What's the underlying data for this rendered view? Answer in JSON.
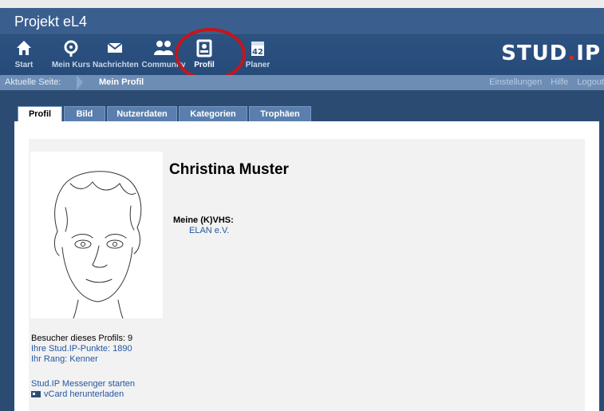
{
  "app": {
    "title": "Projekt eL4",
    "logo_main": "STUD",
    "logo_dot": ".",
    "logo_end": "IP"
  },
  "nav": {
    "items": [
      {
        "label": "Start",
        "icon": "home-icon"
      },
      {
        "label": "Mein Kurs",
        "icon": "course-icon"
      },
      {
        "label": "Nachrichten",
        "icon": "mail-icon"
      },
      {
        "label": "Community",
        "icon": "community-icon"
      },
      {
        "label": "Profil",
        "icon": "profile-icon"
      },
      {
        "label": "Planer",
        "icon": "calendar-icon"
      }
    ],
    "calendar_day": "42"
  },
  "breadcrumb": {
    "label": "Aktuelle Seite:",
    "current": "Mein Profil",
    "links": [
      "Einstellungen",
      "Hilfe",
      "Logout"
    ]
  },
  "tabs": [
    "Profil",
    "Bild",
    "Nutzerdaten",
    "Kategorien",
    "Trophäen"
  ],
  "profile": {
    "name": "Christina Muster",
    "vhs_label": "Meine (K)VHS:",
    "vhs_value": "ELAN e.V.",
    "visitors": "Besucher dieses Profils: 9",
    "points": "Ihre Stud.IP-Punkte: 1890",
    "rank": "Ihr Rang: Kenner",
    "messenger": "Stud.IP Messenger starten",
    "vcard": "vCard herunterladen"
  },
  "colors": {
    "brand_blue": "#2c5282",
    "link": "#2457a3",
    "highlight": "#c3161b",
    "logo_dot": "#d62b1c"
  }
}
